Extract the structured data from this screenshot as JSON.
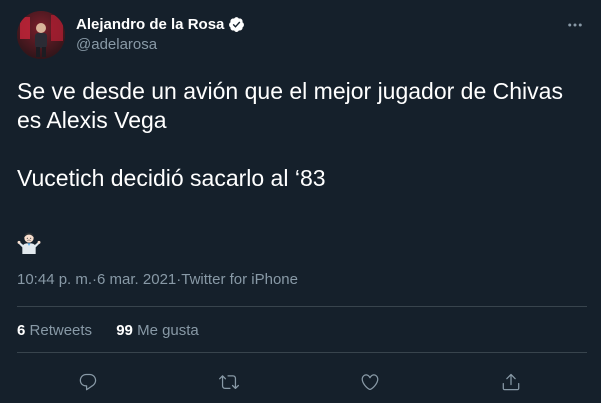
{
  "user": {
    "display_name": "Alejandro de la Rosa",
    "handle": "@adelarosa",
    "verified": true
  },
  "tweet": {
    "paragraphs": [
      "Se ve desde un avión que el mejor jugador de Chivas es Alexis Vega",
      "Vucetich decidió sacarlo al ‘83"
    ],
    "emoji": "person-shrugging-emoji"
  },
  "meta": {
    "time": "10:44 p. m.",
    "separator": " · ",
    "date": "6 mar. 2021",
    "source": "Twitter for iPhone"
  },
  "stats": {
    "retweets_count": "6",
    "retweets_label": "Retweets",
    "likes_count": "99",
    "likes_label": "Me gusta"
  },
  "actions": [
    "reply-icon",
    "retweet-icon",
    "like-icon",
    "share-icon"
  ],
  "colors": {
    "background": "#15202b",
    "text": "#ffffff",
    "secondary": "#8899a6",
    "divider": "#38444d",
    "verified": "#ffffff"
  }
}
